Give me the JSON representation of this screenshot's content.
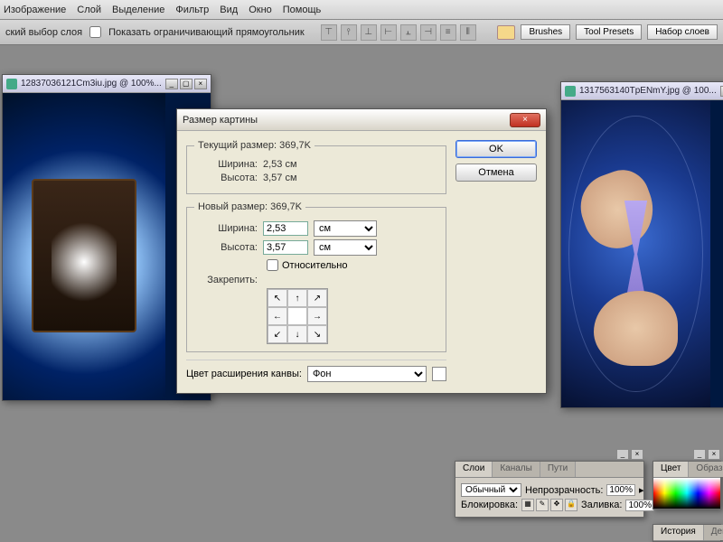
{
  "menubar": [
    "Изображение",
    "Слой",
    "Выделение",
    "Фильтр",
    "Вид",
    "Окно",
    "Помощь"
  ],
  "toolbar": {
    "auto_select_label": "ский выбор слоя",
    "show_bbox_label": "Показать ограничивающий прямоугольник",
    "buttons": [
      "Brushes",
      "Tool Presets",
      "Набор слоев"
    ]
  },
  "docs": {
    "left": {
      "title": "12837036121Cm3iu.jpg @ 100%..."
    },
    "right": {
      "title": "1317563140TpENmY.jpg @ 100..."
    }
  },
  "dialog": {
    "title": "Размер картины",
    "ok": "OK",
    "cancel": "Отмена",
    "current_legend": "Текущий размер:",
    "current_size": "369,7K",
    "width_label": "Ширина:",
    "height_label": "Высота:",
    "cur_width": "2,53 см",
    "cur_height": "3,57 см",
    "new_legend": "Новый размер:",
    "new_size": "369,7K",
    "new_width": "2,53",
    "new_height": "3,57",
    "unit": "см",
    "relative": "Относительно",
    "anchor_label": "Закрепить:",
    "ext_label": "Цвет расширения канвы:",
    "ext_value": "Фон"
  },
  "layers_panel": {
    "tabs": [
      "Слои",
      "Каналы",
      "Пути"
    ],
    "mode": "Обычный",
    "opacity_label": "Непрозрачность:",
    "opacity": "100%",
    "lock_label": "Блокировка:",
    "fill_label": "Заливка:",
    "fill": "100%"
  },
  "color_panel": {
    "tabs": [
      "Цвет",
      "Образцы"
    ]
  },
  "history_panel": {
    "tabs": [
      "История",
      "Дейст"
    ]
  }
}
